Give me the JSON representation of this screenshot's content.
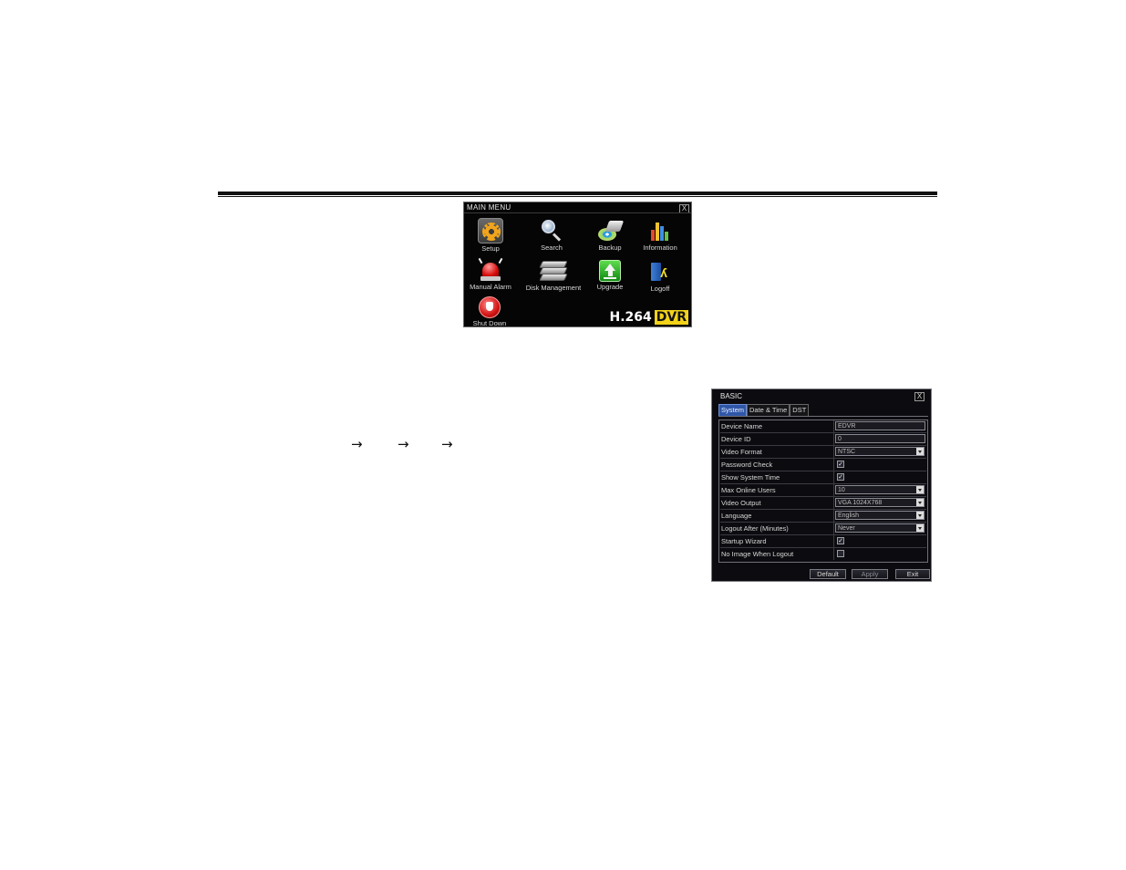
{
  "arrows": [
    "→",
    "→",
    "→"
  ],
  "main_menu": {
    "title": "MAIN MENU",
    "close": "X",
    "items": [
      {
        "label": "Setup",
        "icon": "gear-icon"
      },
      {
        "label": "Search",
        "icon": "magnifier-icon"
      },
      {
        "label": "Backup",
        "icon": "backup-disc-icon"
      },
      {
        "label": "Information",
        "icon": "bar-chart-icon"
      },
      {
        "label": "Manual Alarm",
        "icon": "alarm-siren-icon"
      },
      {
        "label": "Disk Management",
        "icon": "hard-disk-icon"
      },
      {
        "label": "Upgrade",
        "icon": "upload-arrow-icon"
      },
      {
        "label": "Logoff",
        "icon": "exit-door-icon"
      },
      {
        "label": "Shut Down",
        "icon": "power-plug-icon"
      }
    ],
    "brand": {
      "prefix": "H.264",
      "suffix": "DVR",
      "accent": "#f3d21a"
    }
  },
  "basic": {
    "title": "BASIC",
    "close": "X",
    "tabs": [
      "System",
      "Date & Time",
      "DST"
    ],
    "active_tab": "System",
    "accent": "#2f57a8",
    "fields": [
      {
        "label": "Device Name",
        "type": "text",
        "value": "EDVR"
      },
      {
        "label": "Device ID",
        "type": "text",
        "value": "0"
      },
      {
        "label": "Video Format",
        "type": "select",
        "value": "NTSC"
      },
      {
        "label": "Password Check",
        "type": "checkbox",
        "checked": true,
        "mark": "✓"
      },
      {
        "label": "Show System Time",
        "type": "checkbox",
        "checked": true,
        "mark": "✓"
      },
      {
        "label": "Max Online Users",
        "type": "select",
        "value": "10"
      },
      {
        "label": "Video Output",
        "type": "select",
        "value": "VGA 1024X768"
      },
      {
        "label": "Language",
        "type": "select",
        "value": "English"
      },
      {
        "label": "Logout After (Minutes)",
        "type": "select",
        "value": "Never"
      },
      {
        "label": "Startup Wizard",
        "type": "checkbox",
        "checked": true,
        "mark": "✓"
      },
      {
        "label": "No Image When Logout",
        "type": "checkbox",
        "checked": false,
        "mark": ""
      }
    ],
    "buttons": {
      "default": "Default",
      "apply": "Apply",
      "exit": "Exit"
    }
  }
}
